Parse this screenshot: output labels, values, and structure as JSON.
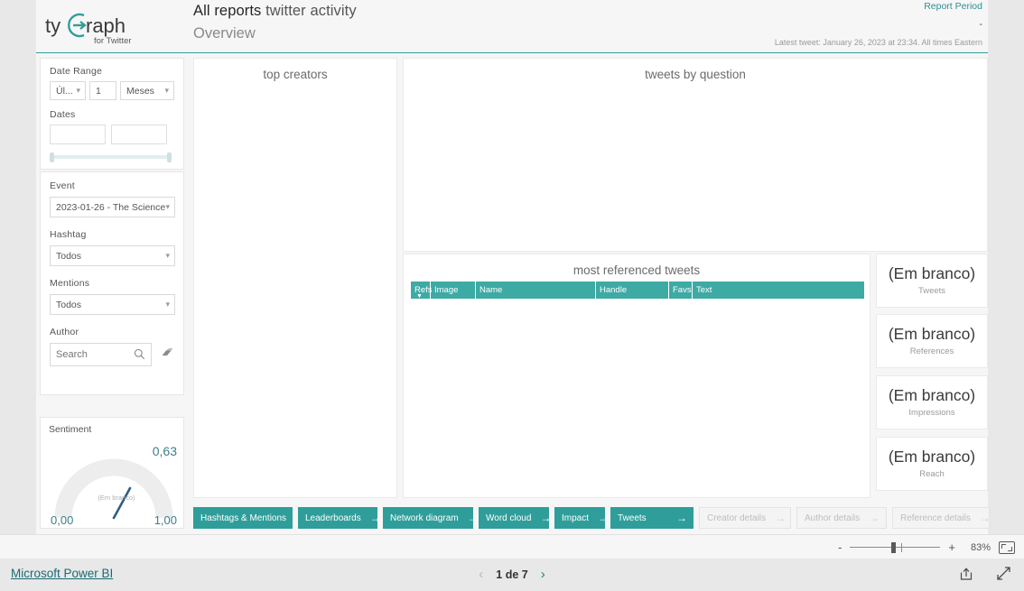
{
  "header": {
    "logo_text_1": "ty",
    "logo_text_2": "raph",
    "logo_tagline": "for Twitter",
    "title_bold": "All reports",
    "title_light": "twitter activity",
    "subtitle": "Overview",
    "report_period_label": "Report Period",
    "report_period_value": "-",
    "latest_tweet": "Latest tweet: January 26, 2023 at 23:34.  All times Eastern"
  },
  "filters": {
    "date_range_label": "Date Range",
    "date_range_mode": "Úl...",
    "date_range_count": "1",
    "date_range_unit": "Meses",
    "dates_label": "Dates",
    "date_from": "",
    "date_to": "",
    "event_label": "Event",
    "event_value": "2023-01-26 - The Science ...",
    "hashtag_label": "Hashtag",
    "hashtag_value": "Todos",
    "mentions_label": "Mentions",
    "mentions_value": "Todos",
    "author_label": "Author",
    "author_placeholder": "Search",
    "search_icon": "search-icon",
    "eraser_icon": "eraser-icon"
  },
  "sentiment": {
    "title": "Sentiment",
    "value": "0,63",
    "min": "0,00",
    "max": "1,00",
    "blank_label": "(Em branco)",
    "needle_ratio": 0.63
  },
  "visuals": {
    "top_creators_title": "top creators",
    "tweets_by_question_title": "tweets by question",
    "most_referenced_title": "most referenced tweets"
  },
  "table": {
    "columns": [
      {
        "label": "Refs",
        "width": 22,
        "sorted": true
      },
      {
        "label": "Image",
        "width": 50,
        "sorted": false
      },
      {
        "label": "Name",
        "width": 133,
        "sorted": false
      },
      {
        "label": "Handle",
        "width": 81,
        "sorted": false
      },
      {
        "label": "Favs",
        "width": 26,
        "sorted": false
      },
      {
        "label": "Text",
        "width": 190,
        "sorted": false
      }
    ],
    "rows": []
  },
  "kpis": [
    {
      "value": "(Em branco)",
      "label": "Tweets"
    },
    {
      "value": "(Em branco)",
      "label": "References"
    },
    {
      "value": "(Em branco)",
      "label": "Impressions"
    },
    {
      "value": "(Em branco)",
      "label": "Reach"
    }
  ],
  "nav_buttons": [
    {
      "label": "Hashtags & Mentions",
      "enabled": true,
      "width": 110
    },
    {
      "label": "Leaderboards",
      "enabled": true,
      "width": 88
    },
    {
      "label": "Network diagram",
      "enabled": true,
      "width": 100
    },
    {
      "label": "Word cloud",
      "enabled": true,
      "width": 78
    },
    {
      "label": "Impact",
      "enabled": true,
      "width": 56
    },
    {
      "label": "Tweets",
      "enabled": true,
      "width": 92
    },
    {
      "label": "Creator details",
      "enabled": false,
      "width": 102
    },
    {
      "label": "Author details",
      "enabled": false,
      "width": 100
    },
    {
      "label": "Reference details",
      "enabled": false,
      "width": 108
    }
  ],
  "zoom": {
    "minus": "-",
    "plus": "+",
    "percent": "83%",
    "fit_icon": "fit-to-page-icon"
  },
  "footer": {
    "powerbi_link": "Microsoft Power BI",
    "page_text": "1 de 7",
    "prev_icon": "chevron-left-icon",
    "next_icon": "chevron-right-icon",
    "share_icon": "share-icon",
    "fullscreen_icon": "fullscreen-icon"
  },
  "colors": {
    "teal": "#2f9e9a",
    "table_header": "#3daaa4",
    "link": "#1a6b73",
    "gauge_text": "#3d7f8a"
  }
}
